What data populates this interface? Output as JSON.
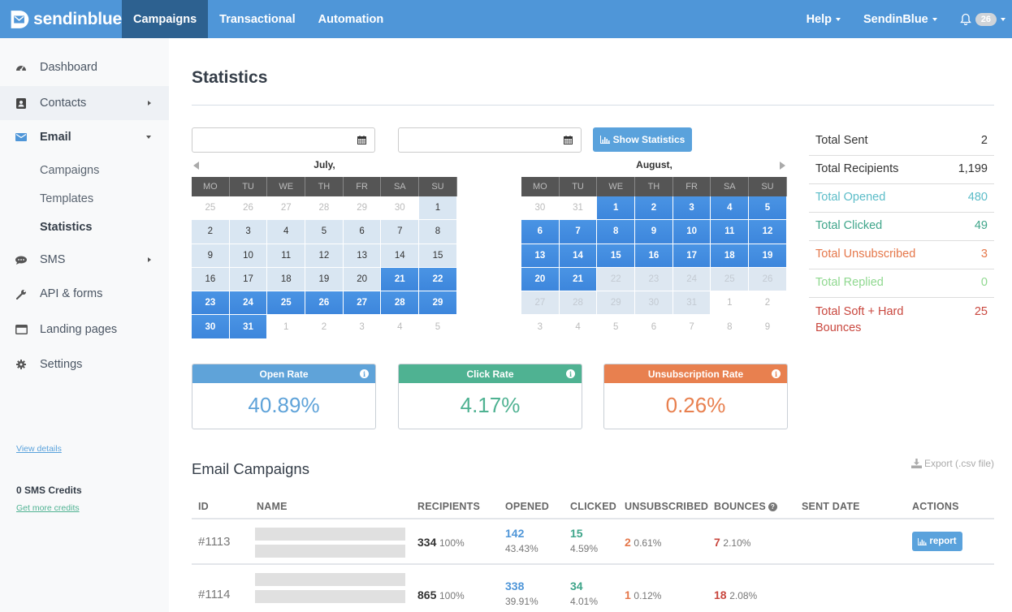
{
  "topbar": {
    "brand": "sendinblue",
    "tabs": [
      {
        "label": "Campaigns",
        "active": true
      },
      {
        "label": "Transactional",
        "active": false
      },
      {
        "label": "Automation",
        "active": false
      }
    ],
    "help_label": "Help",
    "account_label": "SendinBlue",
    "notification_count": "26"
  },
  "sidebar": {
    "items": [
      {
        "label": "Dashboard",
        "icon": "dashboard-icon"
      },
      {
        "label": "Contacts",
        "icon": "contacts-icon"
      },
      {
        "label": "Email",
        "icon": "envelope-icon"
      },
      {
        "label": "SMS",
        "icon": "chat-icon"
      },
      {
        "label": "API & forms",
        "icon": "wrench-icon"
      },
      {
        "label": "Landing pages",
        "icon": "browser-window-icon"
      },
      {
        "label": "Settings",
        "icon": "gear-icon"
      }
    ],
    "email_sub": [
      "Campaigns",
      "Templates",
      "Statistics"
    ],
    "view_details": "View details",
    "sms_credits": "0 SMS Credits",
    "get_more_credits": "Get more credits"
  },
  "main": {
    "title": "Statistics",
    "date_from": {
      "value": "",
      "placeholder": ""
    },
    "date_to": {
      "value": "",
      "placeholder": ""
    },
    "show_statistics_label": "Show Statistics",
    "weekdays": [
      "MO",
      "TU",
      "WE",
      "TH",
      "FR",
      "SA",
      "SU"
    ],
    "calendars": [
      {
        "month": "July,",
        "days": [
          {
            "d": "25",
            "s": "other"
          },
          {
            "d": "26",
            "s": "other"
          },
          {
            "d": "27",
            "s": "other"
          },
          {
            "d": "28",
            "s": "other"
          },
          {
            "d": "29",
            "s": "other"
          },
          {
            "d": "30",
            "s": "other"
          },
          {
            "d": "1",
            "s": "range"
          },
          {
            "d": "2",
            "s": "range"
          },
          {
            "d": "3",
            "s": "range"
          },
          {
            "d": "4",
            "s": "range"
          },
          {
            "d": "5",
            "s": "range"
          },
          {
            "d": "6",
            "s": "range"
          },
          {
            "d": "7",
            "s": "range"
          },
          {
            "d": "8",
            "s": "range"
          },
          {
            "d": "9",
            "s": "range"
          },
          {
            "d": "10",
            "s": "range"
          },
          {
            "d": "11",
            "s": "range"
          },
          {
            "d": "12",
            "s": "range"
          },
          {
            "d": "13",
            "s": "range"
          },
          {
            "d": "14",
            "s": "range"
          },
          {
            "d": "15",
            "s": "range"
          },
          {
            "d": "16",
            "s": "range"
          },
          {
            "d": "17",
            "s": "range"
          },
          {
            "d": "18",
            "s": "range"
          },
          {
            "d": "19",
            "s": "range"
          },
          {
            "d": "20",
            "s": "range"
          },
          {
            "d": "21",
            "s": "sel"
          },
          {
            "d": "22",
            "s": "sel"
          },
          {
            "d": "23",
            "s": "sel"
          },
          {
            "d": "24",
            "s": "sel"
          },
          {
            "d": "25",
            "s": "sel"
          },
          {
            "d": "26",
            "s": "sel"
          },
          {
            "d": "27",
            "s": "sel"
          },
          {
            "d": "28",
            "s": "sel"
          },
          {
            "d": "29",
            "s": "sel"
          },
          {
            "d": "30",
            "s": "sel"
          },
          {
            "d": "31",
            "s": "sel"
          },
          {
            "d": "1",
            "s": "other"
          },
          {
            "d": "2",
            "s": "other"
          },
          {
            "d": "3",
            "s": "other"
          },
          {
            "d": "4",
            "s": "other"
          },
          {
            "d": "5",
            "s": "other"
          }
        ]
      },
      {
        "month": "August,",
        "days": [
          {
            "d": "30",
            "s": "other"
          },
          {
            "d": "31",
            "s": "other"
          },
          {
            "d": "1",
            "s": "sel"
          },
          {
            "d": "2",
            "s": "sel"
          },
          {
            "d": "3",
            "s": "sel"
          },
          {
            "d": "4",
            "s": "sel"
          },
          {
            "d": "5",
            "s": "sel"
          },
          {
            "d": "6",
            "s": "sel"
          },
          {
            "d": "7",
            "s": "sel"
          },
          {
            "d": "8",
            "s": "sel"
          },
          {
            "d": "9",
            "s": "sel"
          },
          {
            "d": "10",
            "s": "sel"
          },
          {
            "d": "11",
            "s": "sel"
          },
          {
            "d": "12",
            "s": "sel"
          },
          {
            "d": "13",
            "s": "sel"
          },
          {
            "d": "14",
            "s": "sel"
          },
          {
            "d": "15",
            "s": "sel"
          },
          {
            "d": "16",
            "s": "sel"
          },
          {
            "d": "17",
            "s": "sel"
          },
          {
            "d": "18",
            "s": "sel"
          },
          {
            "d": "19",
            "s": "sel"
          },
          {
            "d": "20",
            "s": "sel"
          },
          {
            "d": "21",
            "s": "sel"
          },
          {
            "d": "22",
            "s": "dis"
          },
          {
            "d": "23",
            "s": "dis"
          },
          {
            "d": "24",
            "s": "dis"
          },
          {
            "d": "25",
            "s": "dis"
          },
          {
            "d": "26",
            "s": "dis"
          },
          {
            "d": "27",
            "s": "dis"
          },
          {
            "d": "28",
            "s": "dis"
          },
          {
            "d": "29",
            "s": "dis"
          },
          {
            "d": "30",
            "s": "dis"
          },
          {
            "d": "31",
            "s": "dis"
          },
          {
            "d": "1",
            "s": "other"
          },
          {
            "d": "2",
            "s": "other"
          },
          {
            "d": "3",
            "s": "other"
          },
          {
            "d": "4",
            "s": "other"
          },
          {
            "d": "5",
            "s": "other"
          },
          {
            "d": "6",
            "s": "other"
          },
          {
            "d": "7",
            "s": "other"
          },
          {
            "d": "8",
            "s": "other"
          },
          {
            "d": "9",
            "s": "other"
          }
        ]
      }
    ],
    "totals": [
      {
        "label": "Total Sent",
        "value": "2",
        "color": "#333333"
      },
      {
        "label": "Total Recipients",
        "value": "1,199",
        "color": "#333333"
      },
      {
        "label": "Total Opened",
        "value": "480",
        "color": "#5bbcc8"
      },
      {
        "label": "Total Clicked",
        "value": "49",
        "color": "#3fa58a"
      },
      {
        "label": "Total Unsubscribed",
        "value": "3",
        "color": "#e5774a"
      },
      {
        "label": "Total Replied",
        "value": "0",
        "color": "#8fd88f"
      },
      {
        "label": "Total Soft + Hard Bounces",
        "value": "25",
        "color": "#c9473e"
      }
    ],
    "rates": [
      {
        "label": "Open Rate",
        "value": "40.89%",
        "color": "#5fa3d9"
      },
      {
        "label": "Click Rate",
        "value": "4.17%",
        "color": "#4fb292"
      },
      {
        "label": "Unsubscription Rate",
        "value": "0.26%",
        "color": "#e8804f"
      }
    ]
  },
  "campaigns": {
    "title": "Email Campaigns",
    "export_label": "Export (.csv file)",
    "columns": [
      "ID",
      "NAME",
      "RECIPIENTS",
      "OPENED",
      "CLICKED",
      "UNSUBSCRIBED",
      "BOUNCES",
      "SENT DATE",
      "ACTIONS"
    ],
    "rows": [
      {
        "id": "#1113",
        "recipients": "334",
        "recipients_pct": "100%",
        "opened": "142",
        "opened_pct": "43.43%",
        "clicked": "15",
        "clicked_pct": "4.59%",
        "unsub": "2",
        "unsub_pct": "0.61%",
        "bounces": "7",
        "bounces_pct": "2.10%",
        "sent_date": "",
        "action": "report"
      },
      {
        "id": "#1114",
        "recipients": "865",
        "recipients_pct": "100%",
        "opened": "338",
        "opened_pct": "39.91%",
        "clicked": "34",
        "clicked_pct": "4.01%",
        "unsub": "1",
        "unsub_pct": "0.12%",
        "bounces": "18",
        "bounces_pct": "2.08%",
        "sent_date": "",
        "action": ""
      }
    ]
  },
  "colors": {
    "topbar": "#4f96d8",
    "active_tab": "#2d6190",
    "selected_day": "#4a94e4",
    "opened": "#4f96d8",
    "clicked": "#3fa58a",
    "unsub": "#e5774a",
    "bounces": "#c9473e"
  }
}
